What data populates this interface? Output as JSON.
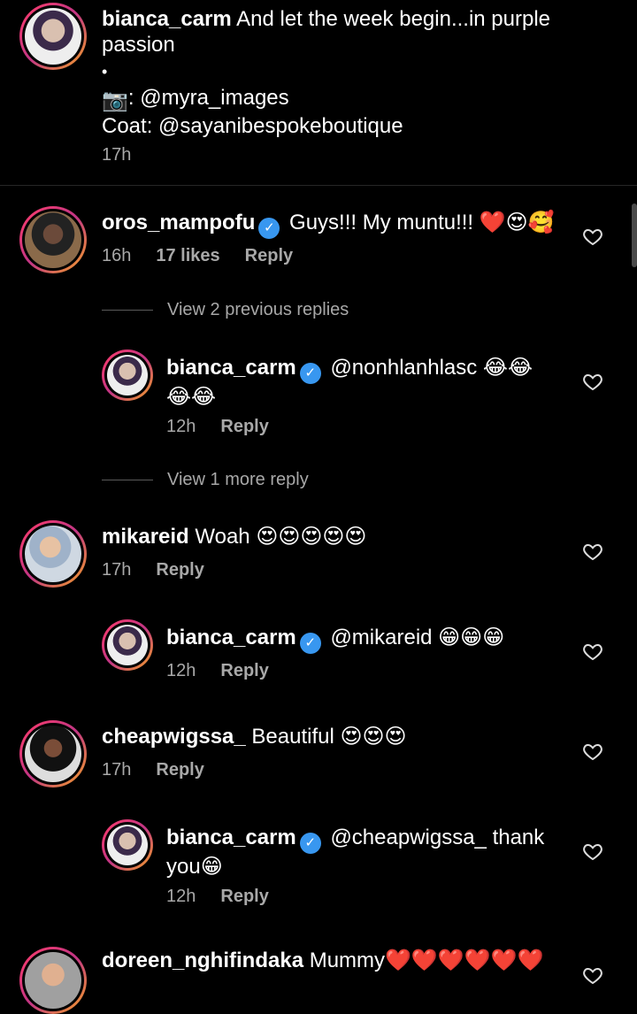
{
  "caption": {
    "username": "bianca_carm",
    "line1": "And let the week begin...in purple",
    "line2": "passion",
    "bullet": "•",
    "camera_icon": "camera-emoji",
    "photo_credit": ": @myra_images",
    "coat_credit": "Coat: @sayanibespokeboutique",
    "time": "17h"
  },
  "comments": [
    {
      "username": "oros_mampofu",
      "text": "Guys!!! My muntu!!! ❤️😍🥰",
      "time": "16h",
      "likes": "17 likes",
      "reply": "Reply",
      "view_replies": "View 2 previous replies",
      "replies": [
        {
          "username": "bianca_carm",
          "text_line1": "@nonhlanhlasc 😂😂",
          "text_line2": "😂😂",
          "time": "12h",
          "reply": "Reply"
        }
      ],
      "view_more": "View 1 more reply"
    },
    {
      "username": "mikareid",
      "text": "Woah 😍😍😍😍😍",
      "time": "17h",
      "reply": "Reply",
      "replies": [
        {
          "username": "bianca_carm",
          "text_line1": "@mikareid 😁😁😁",
          "time": "12h",
          "reply": "Reply"
        }
      ]
    },
    {
      "username": "cheapwigssa_",
      "text": "Beautiful 😍😍😍",
      "time": "17h",
      "reply": "Reply",
      "replies": [
        {
          "username": "bianca_carm",
          "text_line1": "@cheapwigssa_ thank",
          "text_line2": "you😁",
          "time": "12h",
          "reply": "Reply"
        }
      ]
    },
    {
      "username": "doreen_nghifindaka",
      "text": "Mummy❤️❤️❤️❤️❤️❤️"
    }
  ],
  "verified_mark": "✓",
  "colors": {
    "verified": "#3897f0",
    "secondary_text": "#a8a8a8",
    "background": "#000000"
  }
}
